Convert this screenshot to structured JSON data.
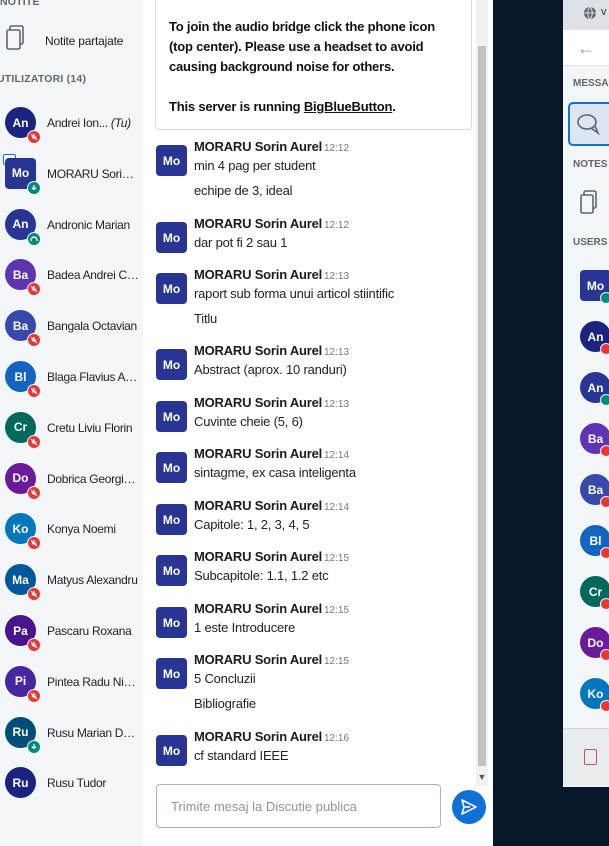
{
  "sidebar": {
    "notes_header": "NOTITE",
    "shared_notes_label": "Notite partajate",
    "users_header": "UTILIZATORI (14)",
    "users": [
      {
        "initials": "An",
        "name": "Andrei Ion...",
        "you": "(Tu)",
        "color": "#1a237e",
        "mic": "muted"
      },
      {
        "initials": "Mo",
        "name": "MORARU Sorin Aurel",
        "color": "#283593",
        "mic": "listen",
        "presenter": true,
        "square": true
      },
      {
        "initials": "An",
        "name": "Andronic Marian",
        "color": "#283593",
        "mic": "headset"
      },
      {
        "initials": "Ba",
        "name": "Badea Andrei Costin",
        "color": "#5e35b1",
        "mic": "muted"
      },
      {
        "initials": "Ba",
        "name": "Bangala Octavian",
        "color": "#3949ab",
        "mic": "muted"
      },
      {
        "initials": "Bl",
        "name": "Blaga Flavius Andrei",
        "color": "#1565c0",
        "mic": "muted"
      },
      {
        "initials": "Cr",
        "name": "Cretu Liviu Florin",
        "color": "#00695c",
        "mic": "muted"
      },
      {
        "initials": "Do",
        "name": "Dobrica Georgiana",
        "color": "#6a1b9a",
        "mic": "muted"
      },
      {
        "initials": "Ko",
        "name": "Konya Noemi",
        "color": "#0277bd",
        "mic": "muted"
      },
      {
        "initials": "Ma",
        "name": "Matyus Alexandru",
        "color": "#01579b",
        "mic": "muted"
      },
      {
        "initials": "Pa",
        "name": "Pascaru Roxana",
        "color": "#4a148c",
        "mic": "muted"
      },
      {
        "initials": "Pi",
        "name": "Pintea Radu Nicolae",
        "color": "#4527a0",
        "mic": "muted"
      },
      {
        "initials": "Ru",
        "name": "Rusu Marian Dorin",
        "color": "#004d7a",
        "mic": "listen"
      },
      {
        "initials": "Ru",
        "name": "Rusu Tudor",
        "color": "#1a237e",
        "mic": "none"
      }
    ]
  },
  "chat": {
    "welcome": {
      "line1": "To join the audio bridge click the phone icon (top center). Please use a headset to avoid causing background noise for others.",
      "line2_prefix": "This server is running ",
      "line2_link": "BigBlueButton",
      "line2_suffix": "."
    },
    "messages": [
      {
        "initials": "Mo",
        "author": "MORARU Sorin Aurel",
        "time": "12:12",
        "lines": [
          "min 4 pag per student",
          "echipe de 3, ideal"
        ]
      },
      {
        "initials": "Mo",
        "author": "MORARU Sorin Aurel",
        "time": "12:12",
        "lines": [
          "dar pot fi 2 sau 1"
        ]
      },
      {
        "initials": "Mo",
        "author": "MORARU Sorin Aurel",
        "time": "12:13",
        "lines": [
          "raport sub forma unui articol stiintific",
          "Titlu"
        ]
      },
      {
        "initials": "Mo",
        "author": "MORARU Sorin Aurel",
        "time": "12:13",
        "lines": [
          "Abstract (aprox. 10 randuri)"
        ]
      },
      {
        "initials": "Mo",
        "author": "MORARU Sorin Aurel",
        "time": "12:13",
        "lines": [
          "Cuvinte cheie (5, 6)"
        ]
      },
      {
        "initials": "Mo",
        "author": "MORARU Sorin Aurel",
        "time": "12:14",
        "lines": [
          "sintagme, ex casa inteligenta"
        ]
      },
      {
        "initials": "Mo",
        "author": "MORARU Sorin Aurel",
        "time": "12:14",
        "lines": [
          "Capitole: 1, 2, 3, 4, 5"
        ]
      },
      {
        "initials": "Mo",
        "author": "MORARU Sorin Aurel",
        "time": "12:15",
        "lines": [
          "Subcapitole: 1.1, 1.2 etc"
        ]
      },
      {
        "initials": "Mo",
        "author": "MORARU Sorin Aurel",
        "time": "12:15",
        "lines": [
          "1 este Introducere"
        ]
      },
      {
        "initials": "Mo",
        "author": "MORARU Sorin Aurel",
        "time": "12:15",
        "lines": [
          "5 Concluzii",
          "Bibliografie"
        ]
      },
      {
        "initials": "Mo",
        "author": "MORARU Sorin Aurel",
        "time": "12:16",
        "lines": [
          "cf standard IEEE"
        ]
      }
    ],
    "input_placeholder": "Trimite mesaj la Discutie publica"
  },
  "right_window": {
    "tab_letter": "v",
    "messages_header": "MESSAGES",
    "notes_header": "NOTES",
    "users_header": "USERS",
    "avatars": [
      {
        "initials": "Mo",
        "color": "#283593",
        "square": true
      },
      {
        "initials": "An",
        "color": "#1a237e"
      },
      {
        "initials": "An",
        "color": "#283593"
      },
      {
        "initials": "Ba",
        "color": "#5e35b1"
      },
      {
        "initials": "Ba",
        "color": "#3949ab"
      },
      {
        "initials": "Bl",
        "color": "#1565c0"
      },
      {
        "initials": "Cr",
        "color": "#00695c"
      },
      {
        "initials": "Do",
        "color": "#6a1b9a"
      },
      {
        "initials": "Ko",
        "color": "#0277bd"
      }
    ]
  },
  "colors": {
    "accent": "#0f70d7",
    "muted": "#e53935",
    "listen": "#00897b",
    "dark_bg": "#06172a"
  }
}
